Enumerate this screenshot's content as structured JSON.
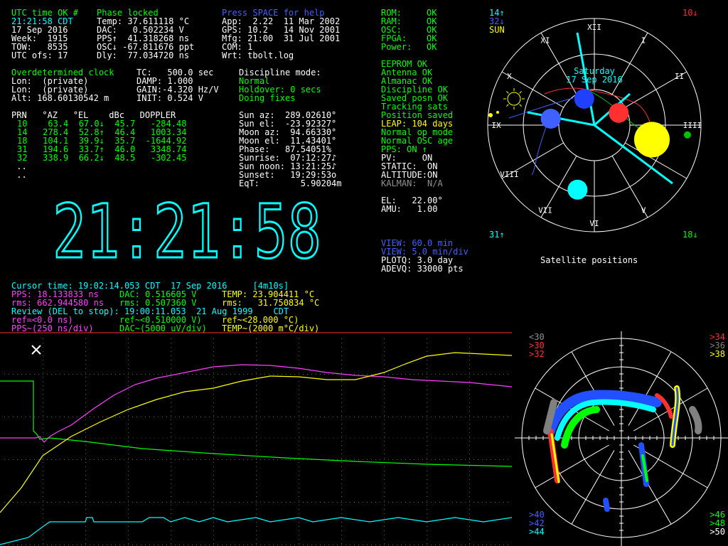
{
  "status": {
    "utc": "UTC time OK #",
    "phase": "Phase locked",
    "help": "Press SPACE for help",
    "time": "21:21:58 CDT",
    "date": "17 Sep 2016",
    "week": "Week:  1915",
    "tow": "TOW:   8535",
    "utcofs": "UTC ofs: 17",
    "temp": "Temp: 37.611118 °C",
    "dac": "DAC:   0.502234 V",
    "pps": "PPS↑  41.318268 ns",
    "osc": "OSC↓ -67.811676 ppt",
    "dly": "Dly:  77.034720 ns",
    "app": "App:  2.22  11 Mar 2002",
    "gps": "GPS: 10.2   14 Nov 2001",
    "mfg": "Mfg: 21:00  31 Jul 2001",
    "com": "COM: 1",
    "wrt": "Wrt: tbolt.log"
  },
  "hw": [
    {
      "k": "ROM:",
      "v": "OK"
    },
    {
      "k": "RAM:",
      "v": "OK"
    },
    {
      "k": "OSC:",
      "v": "OK"
    },
    {
      "k": "FPGA:",
      "v": "OK"
    },
    {
      "k": "Power:",
      "v": "OK"
    }
  ],
  "flags": [
    "EEPROM OK",
    "Antenna OK",
    "Almanac OK",
    "Discipline OK",
    "Saved posn OK",
    "Tracking sats",
    "Position saved"
  ],
  "leap": "LEAP: 104 days",
  "flags2": [
    "Normal op mode",
    "Normal OSC age"
  ],
  "ppson": "PPS: ON ↑",
  "pv": "PV:     ON",
  "static": "STATIC:  ON",
  "altitude": "ALTITUDE:ON",
  "kalman": "KALMAN:  N/A",
  "el": "EL:   22.00°",
  "amu": "AMU:   1.00",
  "position": {
    "clock": "Overdetermined clock",
    "tc": "TC:   500.0 sec",
    "lon1": "Lon:  (private)",
    "damp": "DAMP: 1.000",
    "lon2": "Lon:  (private)",
    "gain": "GAIN:-4.320 Hz/V",
    "alt": "Alt: 168.60130542 m",
    "init": "INIT: 0.524 V"
  },
  "discipline": {
    "title": "Discipline mode:",
    "normal": "Normal",
    "holdover": "Holdover: 0 secs",
    "doing": "Doing fixes"
  },
  "sat_header": "PRN   °AZ   °EL    dBc   DOPPLER",
  "sats": [
    "10    63.4  67.0↓  45.7   -284.48",
    "14   278.4  52.8↑  46.4   1003.34",
    "18   104.1  39.9↓  35.7  -1644.92",
    "31   194.6  33.7↑  46.0   3348.74",
    "32   338.9  66.2↓  48.5   -302.45"
  ],
  "dots": [
    " ..",
    " .."
  ],
  "sun": [
    "Sun az:  289.02610°",
    "Sun el:  -23.92327°",
    "Moon az:  94.66330°",
    "Moon el:  11.43401°",
    "Phase:   87.54051%",
    "Sunrise:  07:12:27♪",
    "Sun noon: 13:21:25♪",
    "Sunset:   19:29:53o",
    "EqT:        5.90204m"
  ],
  "clock_big": "21:21:58",
  "view": {
    "v1": "VIEW: 60.0 min",
    "v2": "VIEW: 5.0 min/div",
    "plotq": "PLOTQ: 3.0 day",
    "adevq": "ADEVQ: 33000 pts"
  },
  "sky": {
    "title": "Satellite positions",
    "date": "17 Sep 2016",
    "day": "Saturday",
    "tl1": "14↑",
    "tl2": "32↓",
    "tl3": "SUN",
    "tr": "10↓",
    "bl": "31↑",
    "br": "18↓",
    "hours": [
      "XII",
      "I",
      "II",
      "IIII",
      "V",
      "VI",
      "VII",
      "VIII",
      "IX",
      "X",
      "XI"
    ],
    "sats": [
      {
        "az": 63.4,
        "el": 67.0,
        "color": "#ff3030",
        "r": 14
      },
      {
        "az": 278.4,
        "el": 52.8,
        "color": "#4060ff",
        "r": 14
      },
      {
        "az": 104.1,
        "el": 39.9,
        "color": "#ffff00",
        "r": 25
      },
      {
        "az": 194.6,
        "el": 33.7,
        "color": "#00ffff",
        "r": 14
      },
      {
        "az": 338.9,
        "el": 66.2,
        "color": "#2040ff",
        "r": 14
      },
      {
        "az": 96,
        "el": 11,
        "color": "#00c000",
        "r": 5
      }
    ]
  },
  "cursor": {
    "line": "Cursor time: 19:02:14.053 CDT  17 Sep 2016     [4m10s]",
    "pps": "PPS: 18.133833 ns",
    "dac": "DAC: 0.516605 V",
    "temp": "TEMP: 23.904411 °C",
    "rms1": "rms: 662.944580 ns",
    "rms2": "rms: 0.507360 V",
    "rms3": "rms:   31.750834 °C",
    "review": "Review (DEL to stop): 19:00:11.053  21 Aug 1999    CDT",
    "ref1": "ref=<0.0 ns)",
    "ref2": "ref~<0.510000 V)",
    "ref3": "ref~<28.000 °C)",
    "s1": "PPS~(250 ns/div)",
    "s2": "DAC~(5000 uV/div)",
    "s3": "TEMP~(2000 m°C/div)"
  },
  "sig": {
    "tl": [
      {
        "t": "<30",
        "c": "#909090"
      },
      {
        "t": ">30",
        "c": "#ff3030"
      },
      {
        "t": ">32",
        "c": "#ff3030"
      }
    ],
    "tr": [
      {
        "t": ">34",
        "c": "#ff3030"
      },
      {
        "t": ">36",
        "c": "#808080"
      },
      {
        "t": ">38",
        "c": "#ffff00"
      }
    ],
    "bl": [
      {
        "t": ">40",
        "c": "#4060ff"
      },
      {
        "t": ">42",
        "c": "#4060ff"
      },
      {
        "t": ">44",
        "c": "#00ffff"
      }
    ],
    "br": [
      {
        "t": ">46",
        "c": "#00ff00"
      },
      {
        "t": ">48",
        "c": "#00ff00"
      },
      {
        "t": ">50",
        "c": "#ffffff"
      }
    ]
  },
  "colors": {
    "green": "#00ff00",
    "cyan": "#00ffff",
    "magenta": "#ff40ff",
    "yellow": "#ffff00",
    "blue": "#4060ff",
    "red": "#ff3030"
  }
}
